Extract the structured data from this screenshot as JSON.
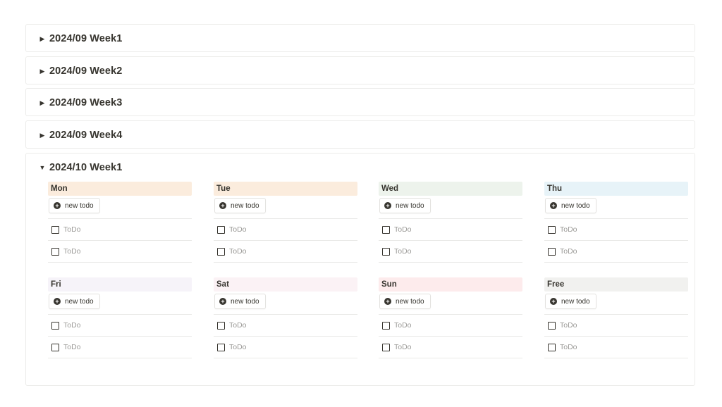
{
  "sections": [
    {
      "title": "2024/09 Week1",
      "expanded": false
    },
    {
      "title": "2024/09 Week2",
      "expanded": false
    },
    {
      "title": "2024/09 Week3",
      "expanded": false
    },
    {
      "title": "2024/09 Week4",
      "expanded": false
    },
    {
      "title": "2024/10 Week1",
      "expanded": true
    }
  ],
  "icons": {
    "collapsed": "▶",
    "expanded": "▼",
    "plus": "+"
  },
  "days": [
    {
      "label": "Mon",
      "color": "#fbecdd",
      "button": "new todo",
      "items": [
        "ToDo",
        "ToDo"
      ]
    },
    {
      "label": "Tue",
      "color": "#fbecdd",
      "button": "new todo",
      "items": [
        "ToDo",
        "ToDo"
      ]
    },
    {
      "label": "Wed",
      "color": "#edf3ec",
      "button": "new todo",
      "items": [
        "ToDo",
        "ToDo"
      ]
    },
    {
      "label": "Thu",
      "color": "#e7f3f8",
      "button": "new todo",
      "items": [
        "ToDo",
        "ToDo"
      ]
    },
    {
      "label": "Fri",
      "color": "#f6f3f9",
      "button": "new todo",
      "items": [
        "ToDo",
        "ToDo"
      ]
    },
    {
      "label": "Sat",
      "color": "#fbf2f5",
      "button": "new todo",
      "items": [
        "ToDo",
        "ToDo"
      ]
    },
    {
      "label": "Sun",
      "color": "#fdebec",
      "button": "new todo",
      "items": [
        "ToDo",
        "ToDo"
      ]
    },
    {
      "label": "Free",
      "color": "#f1f1ef",
      "button": "new todo",
      "items": [
        "ToDo",
        "ToDo"
      ]
    }
  ]
}
